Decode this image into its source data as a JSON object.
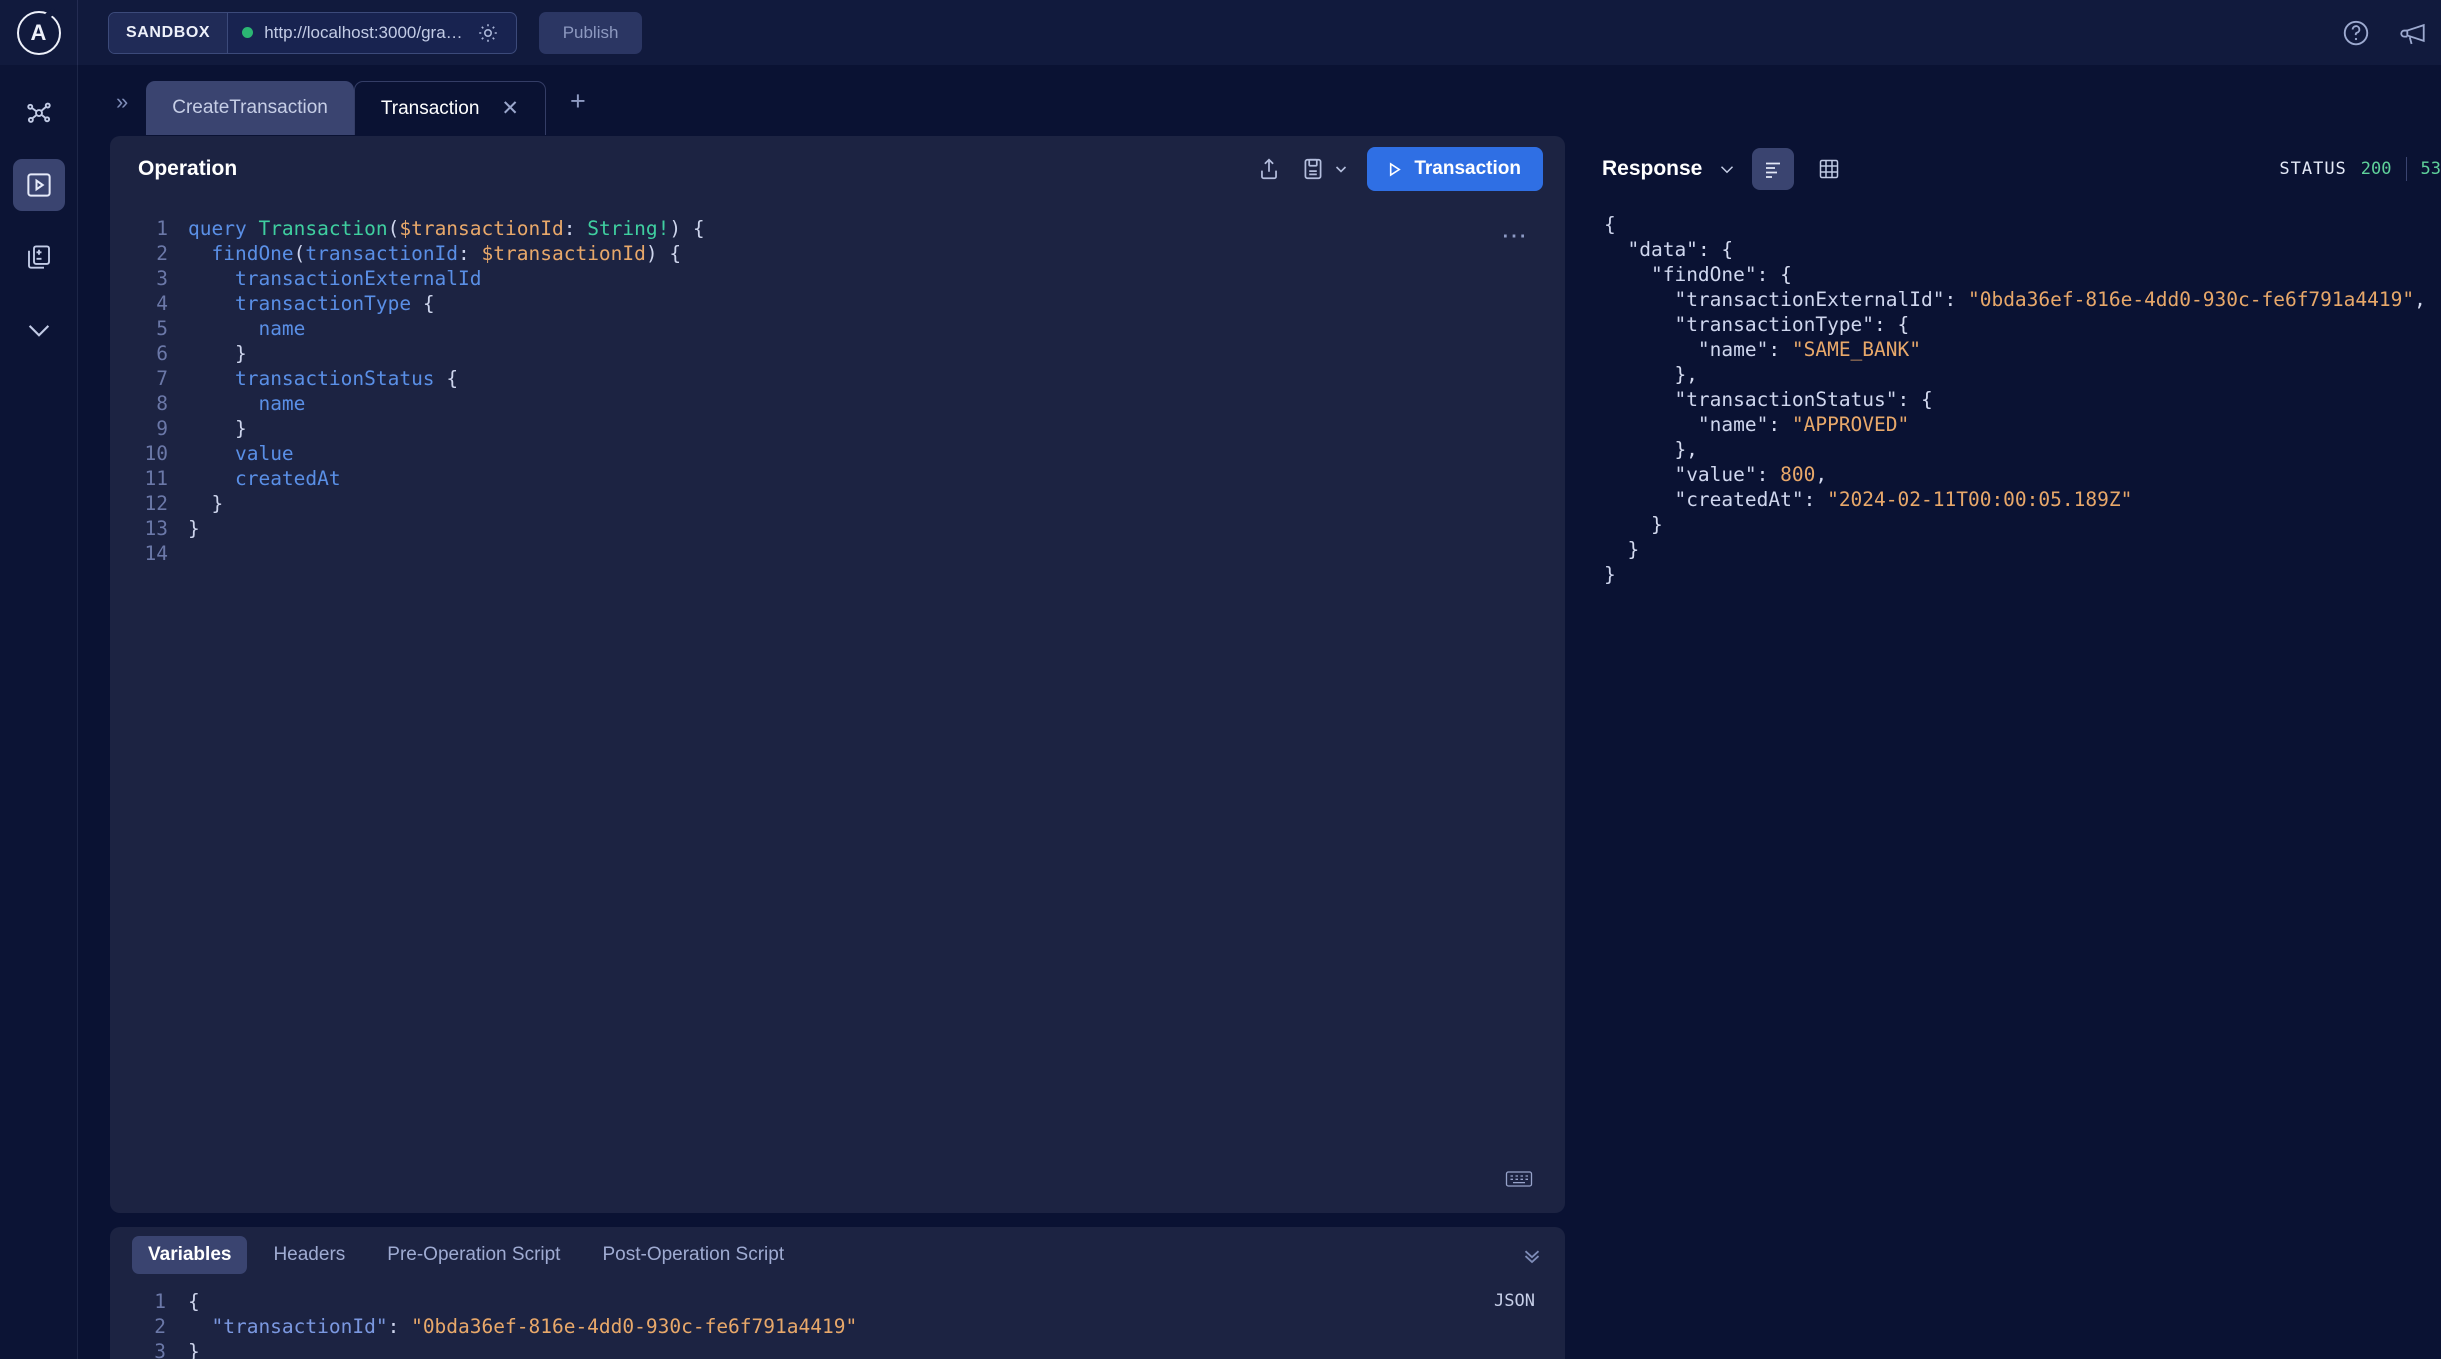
{
  "topbar": {
    "logo_letter": "A",
    "sandbox_label": "SANDBOX",
    "url": "http://localhost:3000/gra…",
    "publish_label": "Publish",
    "gear_icon": "gear-icon",
    "help_icon": "question-circle-icon",
    "announce_icon": "megaphone-icon",
    "connection_status": "connected"
  },
  "rail": {
    "items": [
      {
        "icon": "schema-graph-icon",
        "active": false
      },
      {
        "icon": "play-square-icon",
        "active": true
      },
      {
        "icon": "collections-icon",
        "active": false
      },
      {
        "icon": "check-icon",
        "active": false
      }
    ]
  },
  "tabs": {
    "expand_icon": "chevron-double-right-icon",
    "add_icon": "plus-icon",
    "items": [
      {
        "label": "CreateTransaction",
        "active": false,
        "closable": false
      },
      {
        "label": "Transaction",
        "active": true,
        "closable": true
      }
    ]
  },
  "operation": {
    "title": "Operation",
    "share_icon": "share-upload-icon",
    "save_icon": "save-disk-icon",
    "save_chevron_icon": "chevron-down-icon",
    "run_label": "Transaction",
    "run_icon": "play-icon",
    "menu_icon": "ellipsis-icon",
    "keyboard_icon": "keyboard-icon",
    "code_lines": [
      {
        "n": "1",
        "text": "query Transaction($transactionId: String!) {"
      },
      {
        "n": "2",
        "text": "  findOne(transactionId: $transactionId) {"
      },
      {
        "n": "3",
        "text": "    transactionExternalId"
      },
      {
        "n": "4",
        "text": "    transactionType {"
      },
      {
        "n": "5",
        "text": "      name"
      },
      {
        "n": "6",
        "text": "    }"
      },
      {
        "n": "7",
        "text": "    transactionStatus {"
      },
      {
        "n": "8",
        "text": "      name"
      },
      {
        "n": "9",
        "text": "    }"
      },
      {
        "n": "10",
        "text": "    value"
      },
      {
        "n": "11",
        "text": "    createdAt"
      },
      {
        "n": "12",
        "text": "  }"
      },
      {
        "n": "13",
        "text": "}"
      },
      {
        "n": "14",
        "text": ""
      }
    ]
  },
  "variables_panel": {
    "collapse_icon": "chevron-double-down-icon",
    "format_label": "JSON",
    "tabs": [
      {
        "label": "Variables",
        "active": true
      },
      {
        "label": "Headers",
        "active": false
      },
      {
        "label": "Pre-Operation Script",
        "active": false
      },
      {
        "label": "Post-Operation Script",
        "active": false
      }
    ],
    "lines": [
      {
        "n": "1",
        "text": "{"
      },
      {
        "n": "2",
        "text": "  \"transactionId\": \"0bda36ef-816e-4dd0-930c-fe6f791a4419\""
      },
      {
        "n": "3",
        "text": "}"
      }
    ]
  },
  "response": {
    "title": "Response",
    "chevron_icon": "chevron-down-icon",
    "json_view_icon": "list-lines-icon",
    "table_view_icon": "table-grid-icon",
    "status_label": "STATUS",
    "status_code": "200",
    "time_value": "53",
    "lines": [
      "{",
      "  \"data\": {",
      "    \"findOne\": {",
      "      \"transactionExternalId\": \"0bda36ef-816e-4dd0-930c-fe6f791a4419\",",
      "      \"transactionType\": {",
      "        \"name\": \"SAME_BANK\"",
      "      },",
      "      \"transactionStatus\": {",
      "        \"name\": \"APPROVED\"",
      "      },",
      "      \"value\": 800,",
      "      \"createdAt\": \"2024-02-11T00:00:05.189Z\"",
      "    }",
      "  }",
      "}"
    ]
  },
  "colors": {
    "accent_blue": "#2f6fe4",
    "bg_dark": "#0a1233",
    "panel_bg": "#1c2342",
    "green": "#2bb673",
    "string_orange": "#e8a86a"
  }
}
